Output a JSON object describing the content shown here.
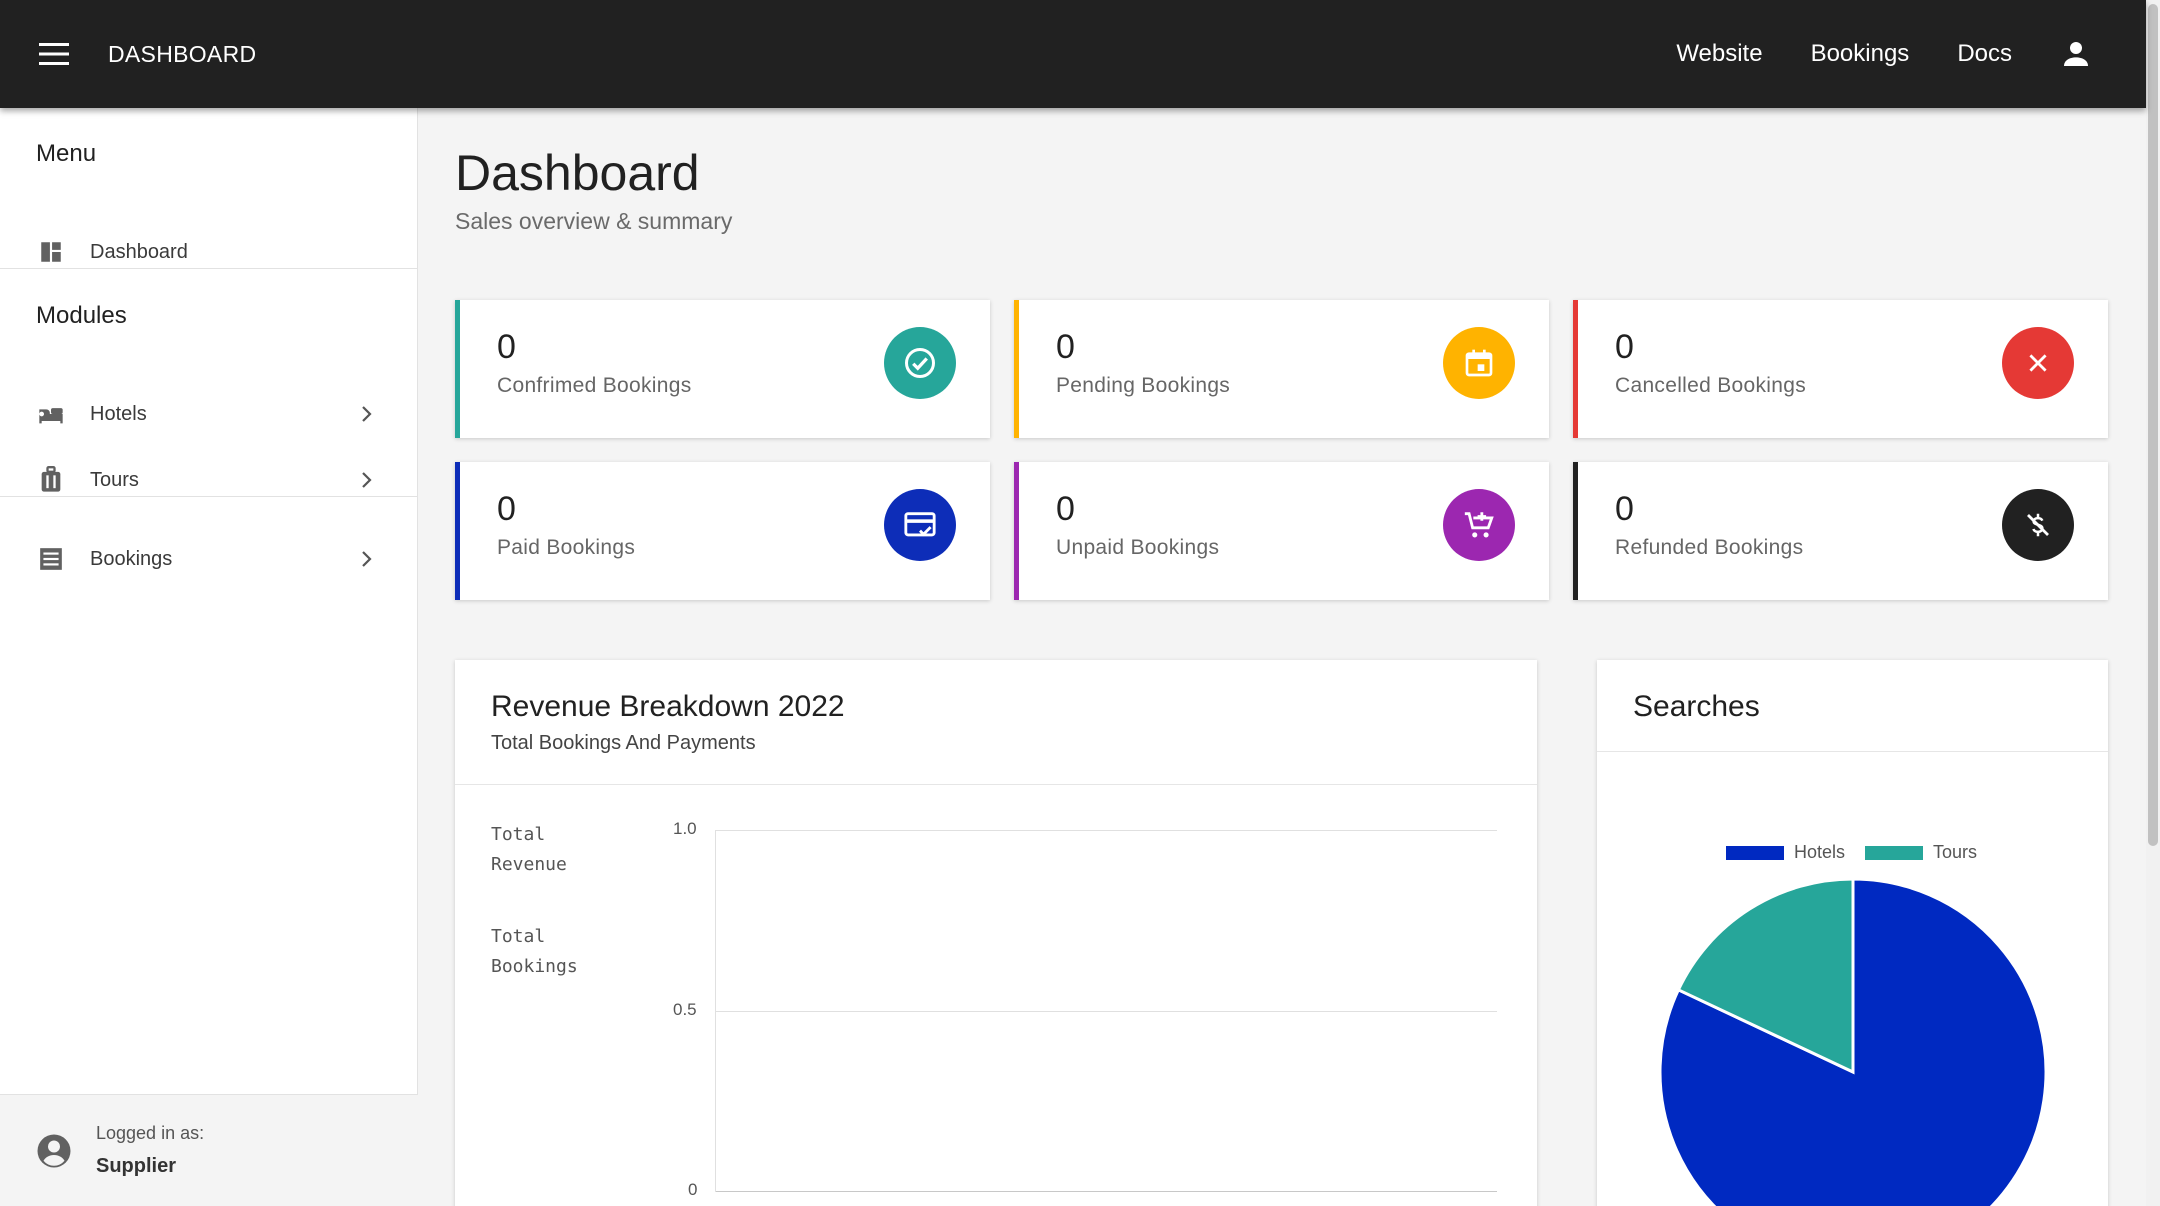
{
  "topbar": {
    "brand": "DASHBOARD",
    "links": [
      "Website",
      "Bookings",
      "Docs"
    ]
  },
  "sidebar": {
    "menu_title": "Menu",
    "menu_items": [
      {
        "label": "Dashboard",
        "icon": "dashboard-icon"
      }
    ],
    "modules_title": "Modules",
    "module_items": [
      {
        "label": "Hotels",
        "icon": "bed-icon"
      },
      {
        "label": "Tours",
        "icon": "luggage-icon"
      }
    ],
    "bookings_item": {
      "label": "Bookings",
      "icon": "list-icon"
    },
    "footer": {
      "logged_label": "Logged in as:",
      "user": "Supplier"
    }
  },
  "page": {
    "title": "Dashboard",
    "subtitle": "Sales overview & summary"
  },
  "stats": [
    {
      "value": "0",
      "label": "Confrimed Bookings",
      "color": "#26a69a",
      "icon": "check-circle-icon"
    },
    {
      "value": "0",
      "label": "Pending Bookings",
      "color": "#ffb300",
      "icon": "calendar-icon"
    },
    {
      "value": "0",
      "label": "Cancelled Bookings",
      "color": "#e53935",
      "icon": "close-icon"
    },
    {
      "value": "0",
      "label": "Paid Bookings",
      "color": "#0d2db8",
      "icon": "card-check-icon"
    },
    {
      "value": "0",
      "label": "Unpaid Bookings",
      "color": "#9c27b0",
      "icon": "cart-icon"
    },
    {
      "value": "0",
      "label": "Refunded Bookings",
      "color": "#212121",
      "icon": "no-money-icon"
    }
  ],
  "revenue_panel": {
    "title": "Revenue Breakdown 2022",
    "subtitle": "Total Bookings And Payments",
    "legend": [
      "Total Revenue",
      "Total Bookings"
    ]
  },
  "searches_panel": {
    "title": "Searches"
  },
  "chart_data": [
    {
      "type": "line",
      "title": "Revenue Breakdown 2022",
      "series": [
        {
          "name": "Total Revenue",
          "values": []
        },
        {
          "name": "Total Bookings",
          "values": []
        }
      ],
      "y_ticks": [
        "1.0",
        "0.5",
        "0"
      ],
      "ylim": [
        0,
        1
      ],
      "grid": true,
      "legend": "left"
    },
    {
      "type": "pie",
      "title": "Searches",
      "categories": [
        "Hotels",
        "Tours"
      ],
      "values": [
        82,
        18
      ],
      "colors": [
        "#0029c1",
        "#26a69a"
      ],
      "legend": "top"
    }
  ]
}
